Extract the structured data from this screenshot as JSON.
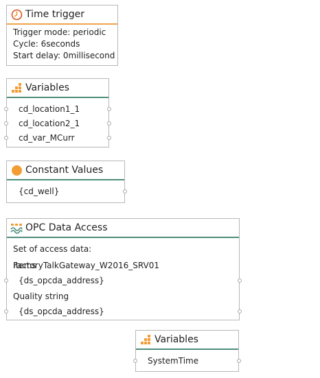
{
  "time_trigger": {
    "title": "Time trigger",
    "icon": "clock-icon",
    "lines": [
      "Trigger mode: periodic",
      "Cycle: 6seconds",
      "Start delay: 0millisecond"
    ]
  },
  "variables_1": {
    "title": "Variables",
    "icon": "bar-stack-icon",
    "items": [
      "cd_location1_1",
      "cd_location2_1",
      "cd_var_MCurr"
    ]
  },
  "constant_values": {
    "title": "Constant Values",
    "icon": "orange-circle-icon",
    "items": [
      "{cd_well}"
    ]
  },
  "opc_data_access": {
    "title": "OPC Data Access",
    "icon": "opc-wave-icon",
    "access_data": "Set of access data: FactoryTalkGateway_W2016_SRV01",
    "items_label": "Items",
    "items_value": "{ds_opcda_address}",
    "quality_label": "Quality string",
    "quality_value": "{ds_opcda_address}"
  },
  "variables_2": {
    "title": "Variables",
    "icon": "bar-stack-icon",
    "items": [
      "SystemTime"
    ]
  },
  "colors": {
    "trigger_separator": "#f0a44a",
    "block_separator": "#4e8c7a",
    "icon_orange": "#f39c33"
  }
}
